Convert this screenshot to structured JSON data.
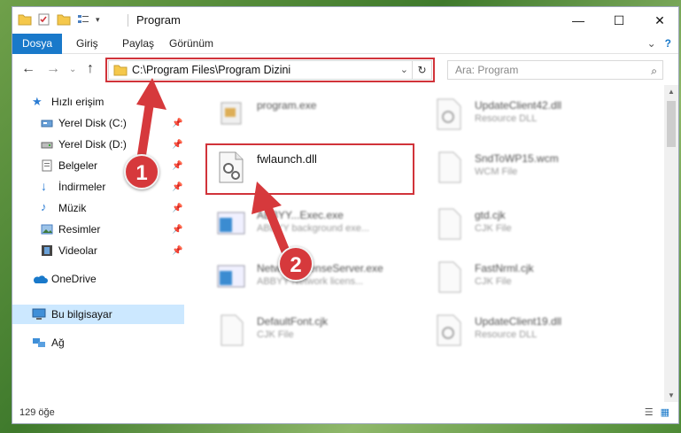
{
  "window": {
    "title": "Program"
  },
  "ribbon": {
    "tabs": [
      "Dosya",
      "Giriş",
      "Paylaş",
      "Görünüm"
    ]
  },
  "address": {
    "path": "C:\\Program Files\\Program Dizini"
  },
  "search": {
    "placeholder": "Ara: Program"
  },
  "sidebar": {
    "items": [
      {
        "label": "Hızlı erişim"
      },
      {
        "label": "Yerel Disk (C:)"
      },
      {
        "label": "Yerel Disk (D:)"
      },
      {
        "label": "Belgeler"
      },
      {
        "label": "İndirmeler"
      },
      {
        "label": "Müzik"
      },
      {
        "label": "Resimler"
      },
      {
        "label": "Videolar"
      },
      {
        "label": "OneDrive"
      },
      {
        "label": "Bu bilgisayar"
      },
      {
        "label": "Ağ"
      }
    ]
  },
  "files": [
    {
      "name": "program.exe",
      "type": ""
    },
    {
      "name": "UpdateClient42.dll",
      "type": "Resource DLL"
    },
    {
      "name": "fwlaunch.dll",
      "type": ""
    },
    {
      "name": "SndToWP15.wcm",
      "type": "WCM File"
    },
    {
      "name": "ABBYY...Exec.exe",
      "type": "ABBYY background exe..."
    },
    {
      "name": "gtd.cjk",
      "type": "CJK File"
    },
    {
      "name": "NetworkLicenseServer.exe",
      "type": "ABBYY Network licens..."
    },
    {
      "name": "FastNrml.cjk",
      "type": "CJK File"
    },
    {
      "name": "DefaultFont.cjk",
      "type": "CJK File"
    },
    {
      "name": "UpdateClient19.dll",
      "type": "Resource DLL"
    }
  ],
  "status": {
    "count": "129 öğe"
  },
  "annotations": {
    "step1": "1",
    "step2": "2"
  },
  "colors": {
    "accent": "#1979ca",
    "highlight": "#d1333a",
    "selected": "#cce8ff"
  }
}
